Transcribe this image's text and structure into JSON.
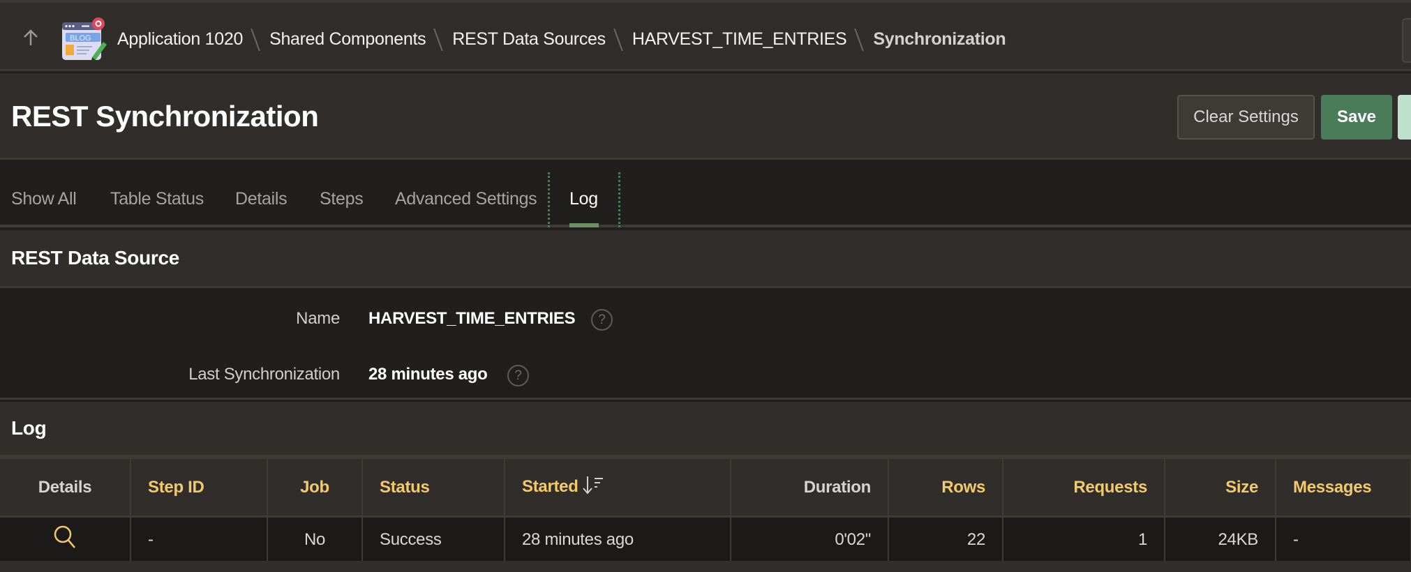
{
  "breadcrumb": {
    "up_icon": "arrow-up-icon",
    "app_icon": "blog-app-icon",
    "items": [
      {
        "label": "Application 1020"
      },
      {
        "label": "Shared Components"
      },
      {
        "label": "REST Data Sources"
      },
      {
        "label": "HARVEST_TIME_ENTRIES"
      },
      {
        "label": "Synchronization",
        "current": true
      }
    ]
  },
  "header": {
    "title": "REST Synchronization",
    "buttons": {
      "clear_settings": "Clear Settings",
      "save": "Save"
    }
  },
  "tabs": [
    {
      "label": "Show All"
    },
    {
      "label": "Table Status"
    },
    {
      "label": "Details"
    },
    {
      "label": "Steps"
    },
    {
      "label": "Advanced Settings"
    },
    {
      "label": "Log",
      "active": true
    }
  ],
  "rest_data_source": {
    "title": "REST Data Source",
    "fields": [
      {
        "label": "Name",
        "value": "HARVEST_TIME_ENTRIES",
        "help_icon": "help-icon"
      },
      {
        "label": "Last Synchronization",
        "value": "28 minutes ago",
        "help_icon": "help-icon"
      }
    ]
  },
  "log": {
    "title": "Log",
    "columns": [
      "Details",
      "Step ID",
      "Job",
      "Status",
      "Started",
      "Duration",
      "Rows",
      "Requests",
      "Size",
      "Messages"
    ],
    "sorted_column": "Started",
    "sort_direction": "descending",
    "rows": [
      {
        "details_icon": "search-icon",
        "step_id": "-",
        "job": "No",
        "status": "Success",
        "started": "28 minutes ago",
        "duration": "0'02\"",
        "rows": "22",
        "requests": "1",
        "size": "24KB",
        "messages": "-"
      }
    ]
  },
  "colors": {
    "accent_header": "#f2c96b",
    "save_button": "#4a7c59",
    "tab_indicator": "#6f8f64",
    "background": "#201f1d",
    "panel": "#312d2a"
  }
}
